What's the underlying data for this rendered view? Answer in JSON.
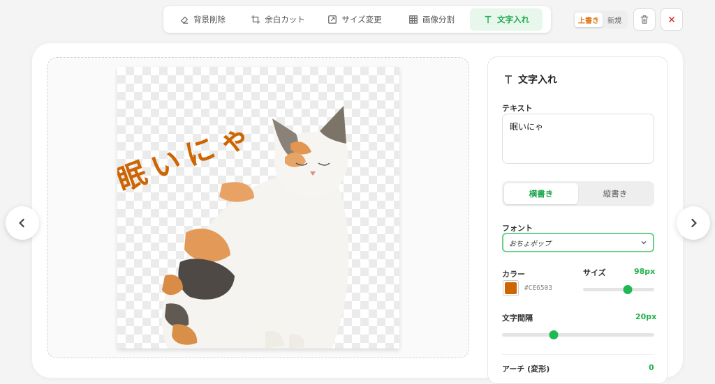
{
  "toolbar": {
    "tabs": [
      {
        "label": "背景削除",
        "icon": "eraser-icon"
      },
      {
        "label": "余白カット",
        "icon": "crop-icon"
      },
      {
        "label": "サイズ変更",
        "icon": "resize-icon"
      },
      {
        "label": "画像分割",
        "icon": "grid-icon"
      },
      {
        "label": "文字入れ",
        "icon": "text-icon"
      }
    ],
    "active_tab": "文字入れ"
  },
  "save_mode": {
    "overwrite": "上書き",
    "new": "新規",
    "selected": "上書き"
  },
  "actions": {
    "delete_icon": "trash-icon",
    "close_icon": "close-icon"
  },
  "canvas": {
    "overlay_text": "眠いにゃ",
    "overlay_color": "#CE6503"
  },
  "navigation": {
    "prev_icon": "chevron-left-icon",
    "next_icon": "chevron-right-icon"
  },
  "panel": {
    "title": "文字入れ",
    "text_label": "テキスト",
    "text_value": "眠いにゃ",
    "orientation": {
      "horizontal": "横書き",
      "vertical": "縦書き",
      "selected": "横書き"
    },
    "font_label": "フォント",
    "font_value": "おちょボップ",
    "color_label": "カラー",
    "color_hex": "#CE6503",
    "size_label": "サイズ",
    "size_value": "98px",
    "size_fraction": 0.63,
    "spacing_label": "文字間隔",
    "spacing_value": "20px",
    "spacing_fraction": 0.34,
    "arch_label": "アーチ (変形)",
    "arch_value": "0"
  },
  "colors": {
    "accent": "#1fb954",
    "text_color": "#CE6503"
  }
}
